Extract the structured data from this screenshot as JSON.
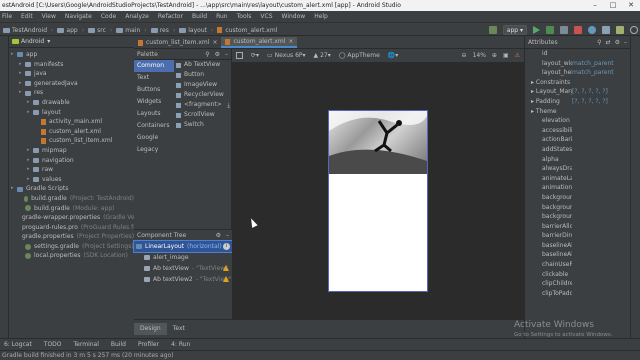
{
  "window": {
    "title": "estAndroid [C:\\Users\\Google\\AndroidStudioProjects\\TestAndroid] - ...\\app\\src\\main\\res\\layout\\custom_alert.xml [app] - Android Studio"
  },
  "menu": [
    "File",
    "Edit",
    "View",
    "Navigate",
    "Code",
    "Analyze",
    "Refactor",
    "Build",
    "Run",
    "Tools",
    "VCS",
    "Window",
    "Help"
  ],
  "breadcrumbs": [
    "TestAndroid",
    "app",
    "src",
    "main",
    "res",
    "layout",
    "custom_alert.xml"
  ],
  "run": {
    "config": "app"
  },
  "project": {
    "view": "Android",
    "tree": [
      {
        "label": "app",
        "indent": 0,
        "type": "folder"
      },
      {
        "label": "manifests",
        "indent": 1,
        "type": "folder"
      },
      {
        "label": "java",
        "indent": 1,
        "type": "folder"
      },
      {
        "label": "generatedJava",
        "indent": 1,
        "type": "folder"
      },
      {
        "label": "res",
        "indent": 1,
        "type": "folder"
      },
      {
        "label": "drawable",
        "indent": 2,
        "type": "folder"
      },
      {
        "label": "layout",
        "indent": 2,
        "type": "folder"
      },
      {
        "label": "activity_main.xml",
        "indent": 3,
        "type": "xml"
      },
      {
        "label": "custom_alert.xml",
        "indent": 3,
        "type": "xml"
      },
      {
        "label": "custom_list_item.xml",
        "indent": 3,
        "type": "xml"
      },
      {
        "label": "mipmap",
        "indent": 2,
        "type": "folder"
      },
      {
        "label": "navigation",
        "indent": 2,
        "type": "folder"
      },
      {
        "label": "raw",
        "indent": 2,
        "type": "folder"
      },
      {
        "label": "values",
        "indent": 2,
        "type": "folder"
      },
      {
        "label": "Gradle Scripts",
        "indent": 0,
        "type": "folder"
      },
      {
        "label": "build.gradle",
        "note": "(Project: TestAndroid)",
        "indent": 1,
        "type": "gradle"
      },
      {
        "label": "build.gradle",
        "note": "(Module: app)",
        "indent": 1,
        "type": "gradle"
      },
      {
        "label": "gradle-wrapper.properties",
        "note": "(Gradle Version",
        "indent": 1,
        "type": "gradle"
      },
      {
        "label": "proguard-rules.pro",
        "note": "(ProGuard Rules for ap",
        "indent": 1,
        "type": "gradle"
      },
      {
        "label": "gradle.properties",
        "note": "(Project Properties)",
        "indent": 1,
        "type": "gradle"
      },
      {
        "label": "settings.gradle",
        "note": "(Project Settings)",
        "indent": 1,
        "type": "gradle"
      },
      {
        "label": "local.properties",
        "note": "(SDK Location)",
        "indent": 1,
        "type": "gradle"
      }
    ]
  },
  "editor_tabs": [
    {
      "label": "custom_list_item.xml",
      "active": false
    },
    {
      "label": "custom_alert.xml",
      "active": true
    }
  ],
  "palette": {
    "title": "Palette",
    "categories": [
      "Common",
      "Text",
      "Buttons",
      "Widgets",
      "Layouts",
      "Containers",
      "Google",
      "Legacy"
    ],
    "selected": 0,
    "items": [
      "Ab TextView",
      "Button",
      "ImageView",
      "RecyclerView",
      "<fragment>",
      "ScrollView",
      "Switch"
    ]
  },
  "component_tree": {
    "title": "Component Tree",
    "rows": [
      {
        "label": "LinearLayout",
        "note": "(horizontal)",
        "indent": 0,
        "selected": true,
        "badge": "info"
      },
      {
        "label": "alert_image",
        "indent": 1,
        "selected": false,
        "badge": ""
      },
      {
        "label": "Ab textView",
        "note": "- \"TextView\"",
        "indent": 1,
        "selected": false,
        "badge": "warn"
      },
      {
        "label": "Ab textView2",
        "note": "- \"TextView\"",
        "indent": 1,
        "selected": false,
        "badge": "warn"
      }
    ]
  },
  "design_toolbar": {
    "device": "Nexus 6P",
    "api": "27",
    "theme": "AppTheme",
    "zoom": "14%"
  },
  "bottom_tabs": [
    {
      "label": "Design",
      "active": true
    },
    {
      "label": "Text",
      "active": false
    }
  ],
  "attributes": {
    "title": "Attributes",
    "rows": [
      {
        "name": "id",
        "value": "",
        "group": false
      },
      {
        "name": "layout_width",
        "value": "match_parent",
        "group": false
      },
      {
        "name": "layout_height",
        "value": "match_parent",
        "group": false
      },
      {
        "name": "Constraints",
        "value": "",
        "group": true
      },
      {
        "name": "Layout_Margin",
        "value": "[?, ?, ?, ?, ?]",
        "group": true
      },
      {
        "name": "Padding",
        "value": "[?, ?, ?, ?, ?]",
        "group": true
      },
      {
        "name": "Theme",
        "value": "",
        "group": true
      },
      {
        "name": "elevation",
        "value": "",
        "group": false
      },
      {
        "name": "accessibilityLiv",
        "value": "",
        "group": false
      },
      {
        "name": "actionBarite",
        "value": "",
        "group": false
      },
      {
        "name": "addStatesFrom",
        "value": "",
        "group": false
      },
      {
        "name": "alpha",
        "value": "",
        "group": false
      },
      {
        "name": "alwaysDrawnW",
        "value": "",
        "group": false
      },
      {
        "name": "animateLayout",
        "value": "",
        "group": false
      },
      {
        "name": "animationCach",
        "value": "",
        "group": false
      },
      {
        "name": "background",
        "value": "",
        "group": false
      },
      {
        "name": "backgroundTin",
        "value": "",
        "group": false
      },
      {
        "name": "backgroundTin",
        "value": "",
        "group": false
      },
      {
        "name": "barrierAllowsG",
        "value": "",
        "group": false
      },
      {
        "name": "barrierDirection",
        "value": "",
        "group": false
      },
      {
        "name": "baselineAligne",
        "value": "",
        "group": false
      },
      {
        "name": "baselineAligne",
        "value": "",
        "group": false
      },
      {
        "name": "chainUseRtl",
        "value": "",
        "group": false
      },
      {
        "name": "clickable",
        "value": "",
        "group": false
      },
      {
        "name": "clipChildren",
        "value": "",
        "group": false
      },
      {
        "name": "clipToPadding",
        "value": "",
        "group": false
      }
    ]
  },
  "tool_windows": [
    "6: Logcat",
    "TODO",
    "Terminal",
    "Build",
    "Profiler",
    "4: Run"
  ],
  "status": {
    "text": "Gradle build finished in 3 m 5 s 257 ms (20 minutes ago)"
  },
  "watermark": {
    "line1": "Activate Windows",
    "line2": "Go to Settings to activate Windows."
  }
}
